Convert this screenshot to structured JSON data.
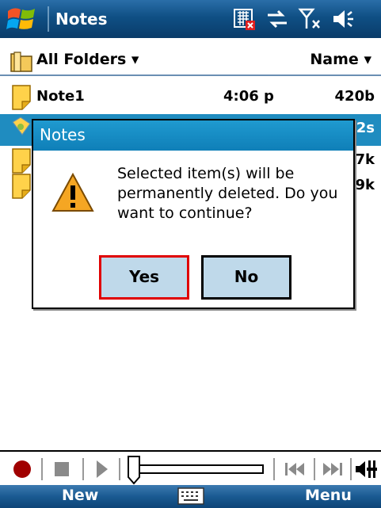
{
  "titlebar": {
    "app_title": "Notes",
    "icons": [
      "windows-start-icon",
      "sim-card-warning-icon",
      "data-sync-icon",
      "no-signal-icon",
      "speaker-icon"
    ]
  },
  "folderbar": {
    "folder_label": "All Folders",
    "sort_label": "Name"
  },
  "notes": [
    {
      "name": "Note1",
      "time": "4:06 p",
      "size": "420b"
    },
    {
      "size": "2s"
    },
    {
      "size": "7k"
    },
    {
      "size": "9k"
    }
  ],
  "dialog": {
    "title": "Notes",
    "message": "Selected item(s) will be permanently deleted. Do you want to continue?",
    "yes_label": "Yes",
    "no_label": "No"
  },
  "mediabar": {
    "icons": [
      "record-icon",
      "stop-icon",
      "play-icon",
      "seek-slider",
      "previous-icon",
      "next-icon",
      "volume-icon"
    ]
  },
  "softkeys": {
    "left": "New",
    "right": "Menu"
  },
  "colors": {
    "title_blue": "#0f4f84",
    "dialog_blue": "#1f9ad0",
    "button_fill": "#bfd9ea",
    "focus_red": "#e00000"
  }
}
